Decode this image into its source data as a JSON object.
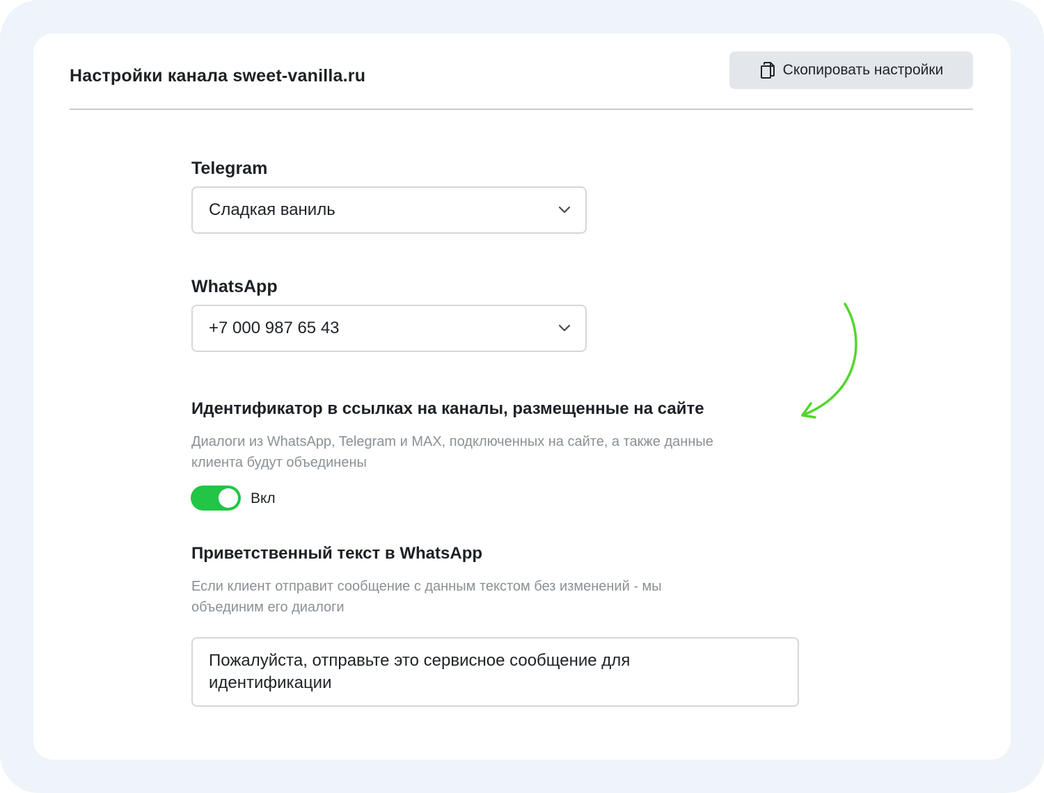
{
  "header": {
    "title": "Настройки канала sweet-vanilla.ru",
    "copy_button_label": "Скопировать настройки"
  },
  "telegram": {
    "label": "Telegram",
    "value": "Сладкая ваниль"
  },
  "whatsapp": {
    "label": "WhatsApp",
    "value": "+7 000 987 65 43"
  },
  "identifier": {
    "title": "Идентификатор в ссылках на каналы, размещенные на сайте",
    "description_line1": "Диалоги из WhatsApp, Telegram и MAX, подключенных на сайте, а также данные",
    "description_line2": "клиента будут объединены",
    "toggle_on": true,
    "toggle_label": "Вкл"
  },
  "greeting": {
    "title": "Приветственный текст в WhatsApp",
    "description_line1": "Если клиент отправит сообщение с данным текстом без изменений - мы",
    "description_line2": "объединим его диалоги",
    "text_line1": "Пожалуйста, отправьте это сервисное сообщение для",
    "text_line2": "идентификации"
  },
  "colors": {
    "accent_green": "#22c545",
    "annotation_arrow": "#52d62a",
    "frame_background": "#eef4f9"
  },
  "icons": {
    "copy": "copy-icon",
    "dropdown": "chevron-down-icon",
    "annotation": "curved-arrow-icon"
  }
}
